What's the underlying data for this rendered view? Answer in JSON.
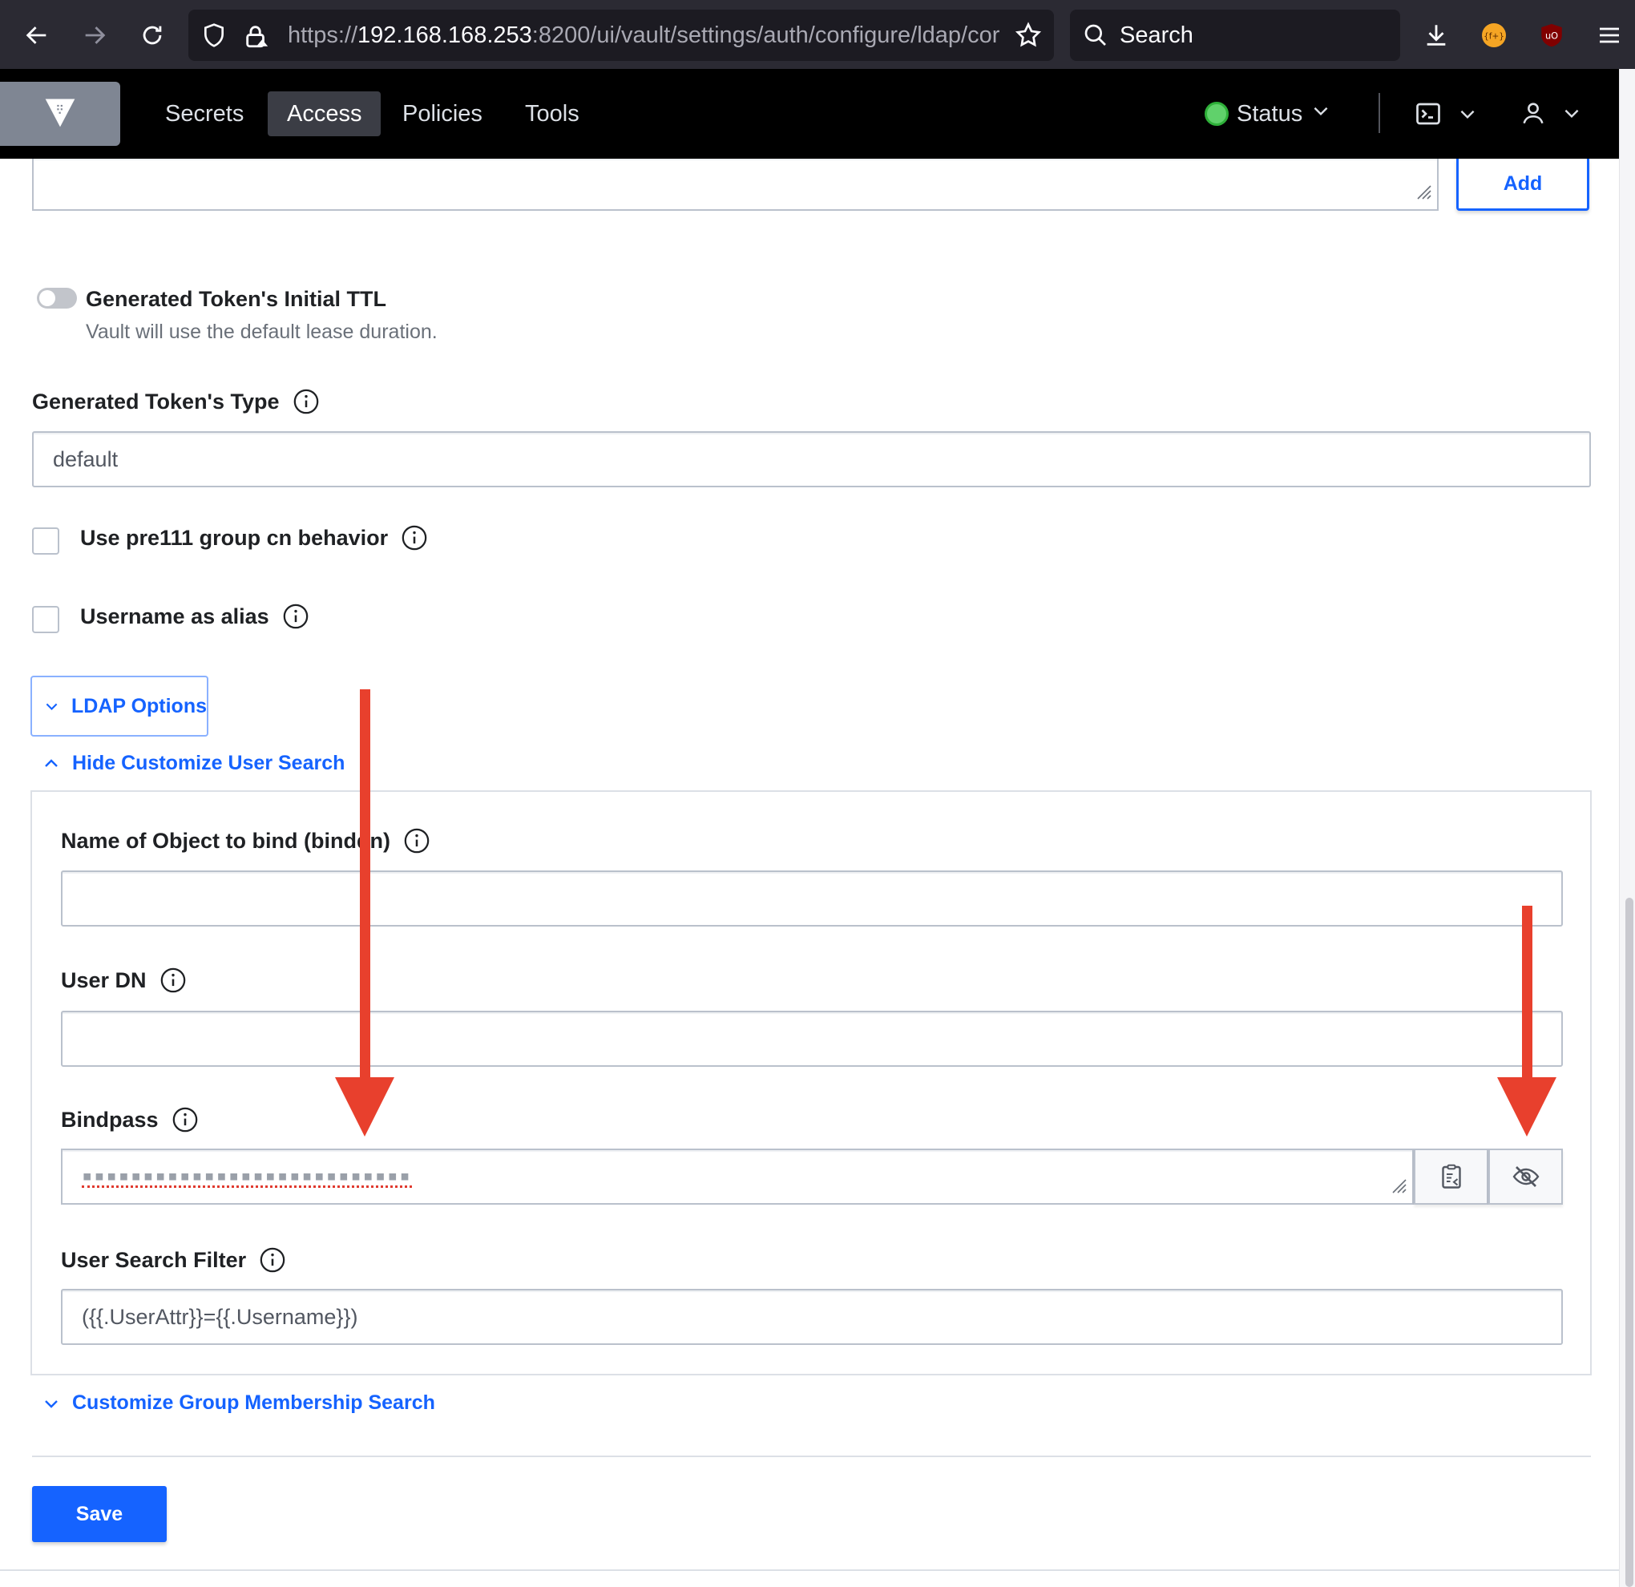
{
  "browser": {
    "url_prefix": "https://",
    "url_host": "192.168.168.253",
    "url_rest": ":8200/ui/vault/settings/auth/configure/ldap/cor",
    "search_label": "Search"
  },
  "nav": {
    "items": [
      {
        "label": "Secrets"
      },
      {
        "label": "Access"
      },
      {
        "label": "Policies"
      },
      {
        "label": "Tools"
      }
    ],
    "status_label": "Status"
  },
  "form": {
    "add_label": "Add",
    "ttl": {
      "title": "Generated Token's Initial TTL",
      "help": "Vault will use the default lease duration."
    },
    "token_type": {
      "title": "Generated Token's Type",
      "value": "default"
    },
    "pre111": {
      "title": "Use pre111 group cn behavior"
    },
    "username_alias": {
      "title": "Username as alias"
    },
    "ldap_options_label": "LDAP Options",
    "hide_user_search_label": "Hide Customize User Search",
    "binddn": {
      "title": "Name of Object to bind (binddn)",
      "value": ""
    },
    "userdn": {
      "title": "User DN",
      "value": ""
    },
    "bindpass": {
      "title": "Bindpass",
      "masked": "▪▪▪▪▪▪▪▪▪▪▪▪▪▪▪▪▪▪▪▪▪▪▪▪▪▪▪"
    },
    "userfilter": {
      "title": "User Search Filter",
      "value": "({{.UserAttr}}={{.Username}})"
    },
    "group_search_label": "Customize Group Membership Search",
    "save_label": "Save"
  },
  "colors": {
    "accent": "#1563ff",
    "annotation_arrow": "#e8402d",
    "status_ok": "#60d16b"
  },
  "icons": [
    "back-arrow-icon",
    "forward-arrow-icon",
    "reload-icon",
    "shield-icon",
    "lock-icon",
    "star-icon",
    "search-icon",
    "download-icon",
    "extension-icon",
    "ublock-icon",
    "hamburger-menu-icon",
    "vault-logo-icon",
    "chevron-down-icon",
    "terminal-icon",
    "user-icon",
    "info-icon",
    "copy-icon",
    "eye-off-icon",
    "chevron-up-icon"
  ]
}
